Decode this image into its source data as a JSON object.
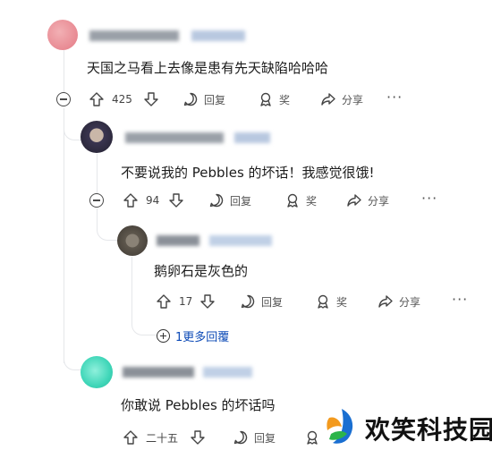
{
  "comments": [
    {
      "text": "天国之马看上去像是患有先天缺陷哈哈哈",
      "votes": "425",
      "reply_label": "回复",
      "award_label": "奖",
      "share_label": "分享",
      "avatar_color": "#e89aa0"
    },
    {
      "text": "不要说我的 Pebbles 的坏话！我感觉很饿!",
      "votes": "94",
      "reply_label": "回复",
      "award_label": "奖",
      "share_label": "分享",
      "avatar_color": "#3a3550"
    },
    {
      "text": "鹅卵石是灰色的",
      "votes": "17",
      "reply_label": "回复",
      "award_label": "奖",
      "share_label": "分享",
      "avatar_color": "#5e574d"
    },
    {
      "text": "你敢说 Pebbles 的坏话吗",
      "votes": "二十五",
      "reply_label": "回复",
      "avatar_color": "#3fd6b8"
    }
  ],
  "more_replies_label": "1更多回覆",
  "watermark": {
    "text": "欢笑科技园",
    "colors": [
      "#1a6fd1",
      "#f39a1e",
      "#2bb44a"
    ]
  },
  "icons": [
    "collapse-icon",
    "upvote-icon",
    "downvote-icon",
    "comment-icon",
    "award-icon",
    "share-icon",
    "more-icon",
    "expand-icon"
  ]
}
